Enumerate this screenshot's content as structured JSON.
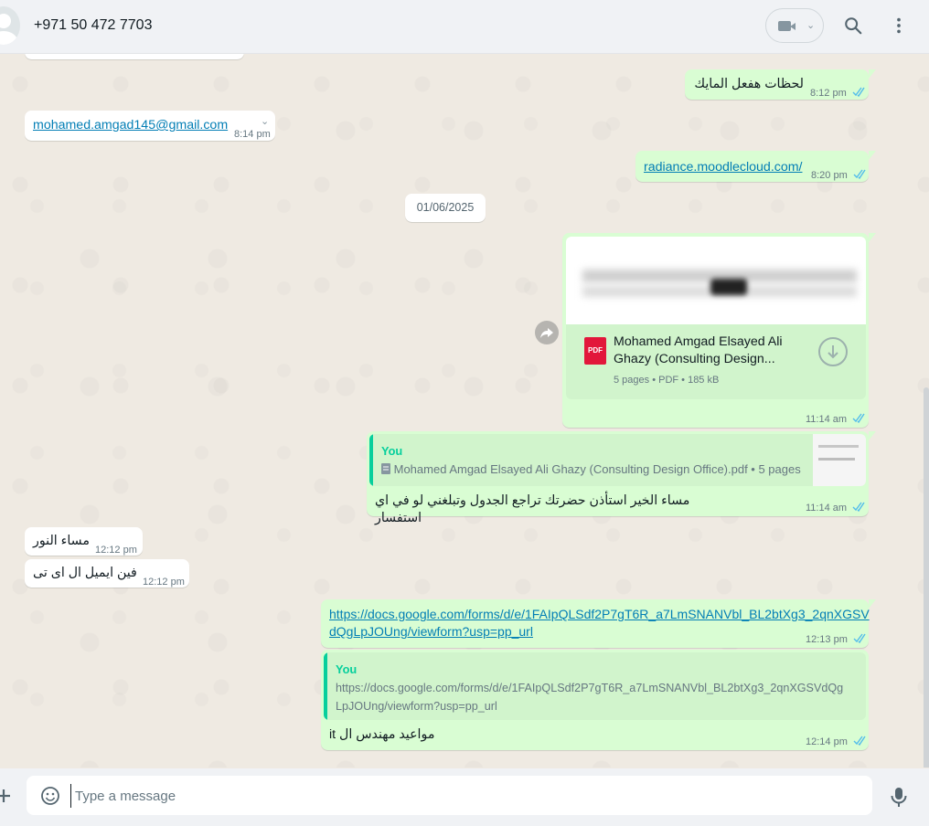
{
  "header": {
    "contact_name": "+971 50 472 7703",
    "icons": [
      "avatar",
      "video-call-icon",
      "chevron-down-icon",
      "search-icon",
      "menu-icon"
    ]
  },
  "messages": {
    "m1": {
      "text": "لحظات هفعل المايك",
      "time": "8:12 pm"
    },
    "m2": {
      "text": "mohamed.amgad145@gmail.com",
      "time": "8:14 pm"
    },
    "m3": {
      "text": "radiance.moodlecloud.com/",
      "time": "8:20 pm"
    },
    "date_divider": "01/06/2025",
    "m4": {
      "doc_title": "Mohamed Amgad Elsayed Ali Ghazy (Consulting Design...",
      "doc_meta": "5 pages • PDF • 185 kB",
      "pdf_label": "PDF",
      "time": "11:14 am"
    },
    "m5": {
      "quote_author": "You",
      "quote_text": "Mohamed Amgad Elsayed Ali Ghazy (Consulting Design Office).pdf • 5 pages",
      "text": "مساء الخير استأذن حضرتك تراجع الجدول وتبلغني لو في اي استفسار",
      "time": "11:14 am"
    },
    "m6": {
      "text": "مساء النور",
      "time": "12:12 pm"
    },
    "m7": {
      "text": "فين ايميل ال اى تى",
      "time": "12:12 pm"
    },
    "m8": {
      "line1": "https://docs.google.com/forms/d/e/1FAIpQLSdf2P7gT6R_a7LmSNANVbl_BL2btXg3_2qnXGSV",
      "line2": "dQgLpJOUng/viewform?usp=pp_url",
      "time": "12:13 pm"
    },
    "m9": {
      "quote_author": "You",
      "quote_line1": "https://docs.google.com/forms/d/e/1FAIpQLSdf2P7gT6R_a7LmSNANVbl_BL2btXg3_2qnXGSVdQg",
      "quote_line2": "LpJOUng/viewform?usp=pp_url",
      "text": "مواعيد مهندس ال it",
      "time": "12:14 pm"
    }
  },
  "composer": {
    "placeholder": "Type a message"
  },
  "colors": {
    "outgoing_bubble": "#d9fdd3",
    "incoming_bubble": "#ffffff",
    "read_ticks": "#53bdeb",
    "quote_accent": "#06cf9c",
    "link": "#027eb5"
  }
}
